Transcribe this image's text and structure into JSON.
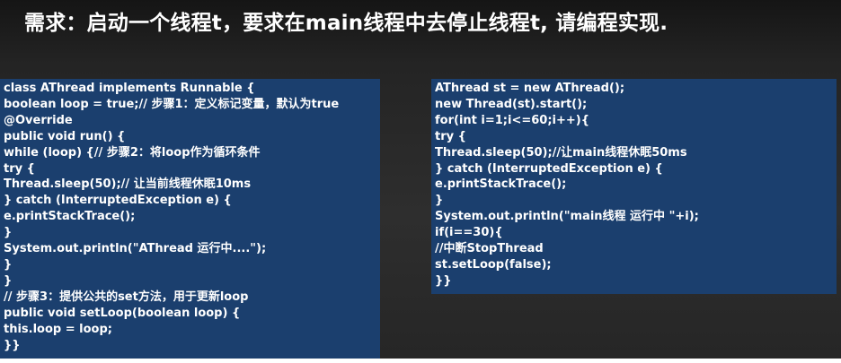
{
  "title": "需求：启动一个线程t，要求在main线程中去停止线程t, 请编程实现.",
  "left_code": [
    "class AThread implements Runnable {",
    "boolean loop = true;// 步骤1：定义标记变量，默认为true",
    "@Override",
    "public void run() {",
    "while (loop) {// 步骤2：将loop作为循环条件",
    "try {",
    "Thread.sleep(50);// 让当前线程休眠10ms",
    "} catch (InterruptedException e) {",
    "e.printStackTrace();",
    "}",
    "System.out.println(\"AThread 运行中....\");",
    "}",
    "}",
    "// 步骤3：提供公共的set方法，用于更新loop",
    "public void setLoop(boolean loop) {",
    "this.loop = loop;",
    "}}"
  ],
  "right_code": [
    "AThread st = new AThread();",
    "new Thread(st).start();",
    "for(int i=1;i<=60;i++){",
    "try {",
    "Thread.sleep(50);//让main线程休眠50ms",
    "} catch (InterruptedException e) {",
    "e.printStackTrace();",
    "}",
    "System.out.println(\"main线程 运行中 \"+i);",
    "if(i==30){",
    "//中断StopThread",
    "st.setLoop(false);",
    "}}"
  ]
}
